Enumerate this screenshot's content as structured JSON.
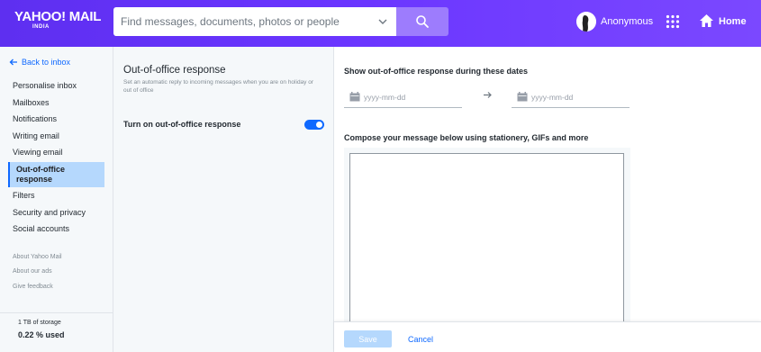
{
  "header": {
    "logo_text": "YAHOO! MAIL",
    "logo_subtext": "INDIA",
    "search_placeholder": "Find messages, documents, photos or people",
    "user_name": "Anonymous",
    "home_label": "Home",
    "colors": {
      "header_start": "#5e2ff0",
      "header_end": "#7b48ff",
      "search_button": "#9d7cfd"
    }
  },
  "sidebar": {
    "back_label": "Back to inbox",
    "items": [
      {
        "label": "Personalise inbox",
        "active": false
      },
      {
        "label": "Mailboxes",
        "active": false
      },
      {
        "label": "Notifications",
        "active": false
      },
      {
        "label": "Writing email",
        "active": false
      },
      {
        "label": "Viewing email",
        "active": false
      },
      {
        "label": "Out-of-office response",
        "active": true
      },
      {
        "label": "Filters",
        "active": false
      },
      {
        "label": "Security and privacy",
        "active": false
      },
      {
        "label": "Social accounts",
        "active": false
      }
    ],
    "links": [
      "About Yahoo Mail",
      "About our ads",
      "Give feedback"
    ],
    "storage_total": "1 TB of storage",
    "storage_used": "0.22 % used"
  },
  "settings": {
    "title": "Out-of-office response",
    "description": "Set an automatic reply to incoming messages when you are on holiday or out of office",
    "toggle_label": "Turn on out-of-office response",
    "toggle_on": true
  },
  "compose": {
    "dates_label": "Show out-of-office response during these dates",
    "start_placeholder": "yyyy-mm-dd",
    "end_placeholder": "yyyy-mm-dd",
    "message_label": "Compose your message below using stationery, GIFs and more",
    "message_value": "",
    "save_label": "Save",
    "cancel_label": "Cancel"
  },
  "icons": [
    "arrow-left-icon",
    "chevron-down-icon",
    "search-icon",
    "avatar",
    "apps-grid-icon",
    "home-icon",
    "calendar-icon",
    "arrow-right-icon"
  ]
}
